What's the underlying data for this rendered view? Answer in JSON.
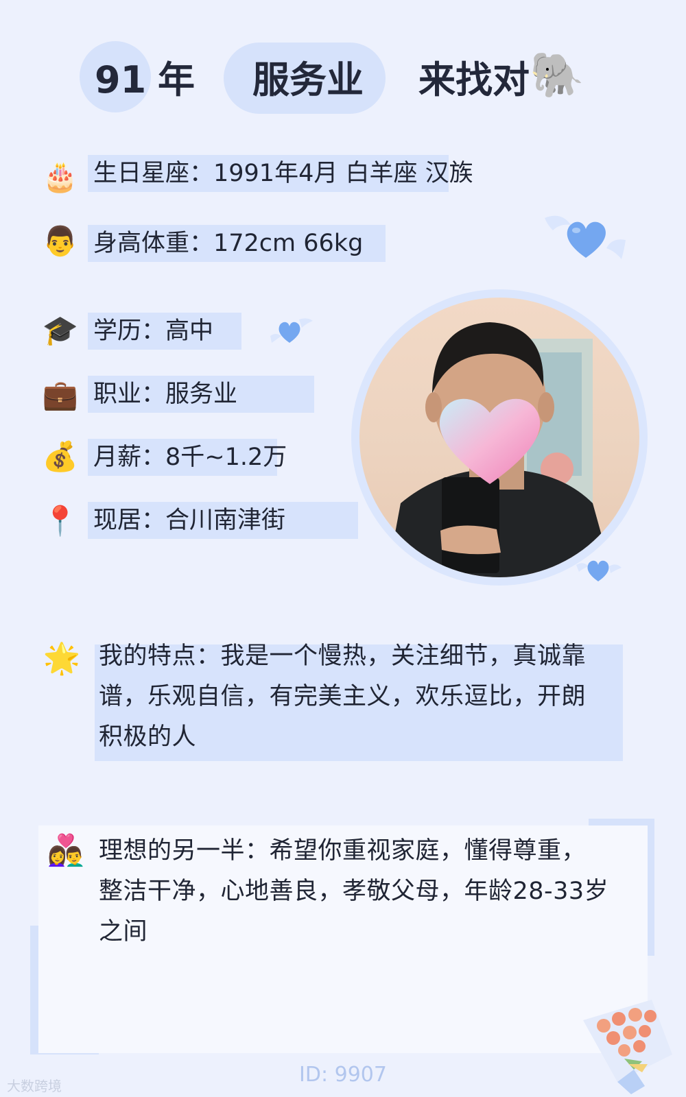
{
  "header": {
    "year_num": "91",
    "year_unit": "年",
    "industry": "服务业",
    "tagline": "来找对",
    "tagline_emoji": "🐘"
  },
  "info": {
    "birthday": {
      "icon": "cake-icon",
      "emoji": "🎂",
      "text": "生日星座：1991年4月 白羊座 汉族"
    },
    "body": {
      "icon": "man-face-icon",
      "emoji": "👨",
      "text": "身高体重：172cm 66kg"
    },
    "education": {
      "icon": "graduation-cap-icon",
      "emoji": "🎓",
      "text": "学历：高中"
    },
    "job": {
      "icon": "briefcase-icon",
      "emoji": "💼",
      "text": "职业：服务业"
    },
    "salary": {
      "icon": "money-bag-icon",
      "emoji": "💰",
      "text": "月薪：8千~1.2万"
    },
    "location": {
      "icon": "location-pin-icon",
      "emoji": "📍",
      "text": "现居：合川南津街"
    }
  },
  "traits": {
    "icon": "star-icon",
    "emoji": "🌟",
    "lines": [
      "我的特点：我是一个慢热，关注细节，真诚靠",
      "谱，乐观自信，有完美主义，欢乐逗比，开朗",
      "积极的人"
    ]
  },
  "ideal": {
    "icon": "couple-heart-icon",
    "emoji": "👩‍❤️‍👨",
    "lines": [
      "理想的另一半：希望你重视家庭，懂得尊重，",
      "整洁干净，心地善良，孝敬父母，年龄28-33岁",
      "之间"
    ]
  },
  "footer": {
    "id": "ID: 9907"
  },
  "watermark": "大数跨境",
  "colors": {
    "background": "#edf1fd",
    "highlight": "#d7e3fc",
    "heart": "#74a7f0",
    "id_text": "#b2c6ee"
  }
}
